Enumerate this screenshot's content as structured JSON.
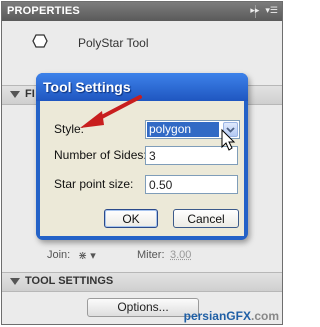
{
  "panel": {
    "title": "PROPERTIES",
    "tool_icon": "polystar-hexagon-icon",
    "tool_name": "PolyStar Tool",
    "sections": [
      {
        "label": "FI"
      },
      {
        "label": "TOOL SETTINGS"
      }
    ],
    "stroke": {
      "join_label": "Join:",
      "miter_label": "Miter:",
      "miter_value": "3.00"
    },
    "options_button": "Options..."
  },
  "dialog": {
    "title": "Tool Settings",
    "style_label": "Style:",
    "style_value": "polygon",
    "sides_label": "Number of Sides:",
    "sides_value": "3",
    "star_label": "Star point size:",
    "star_value": "0.50",
    "ok_label": "OK",
    "cancel_label": "Cancel"
  },
  "watermark": {
    "brand_a": "persianGFX",
    "brand_b": ".com"
  },
  "colors": {
    "dialog_title_blue": "#2462c7",
    "selection_blue": "#316ac5",
    "annotation_arrow": "#c81e1e"
  }
}
